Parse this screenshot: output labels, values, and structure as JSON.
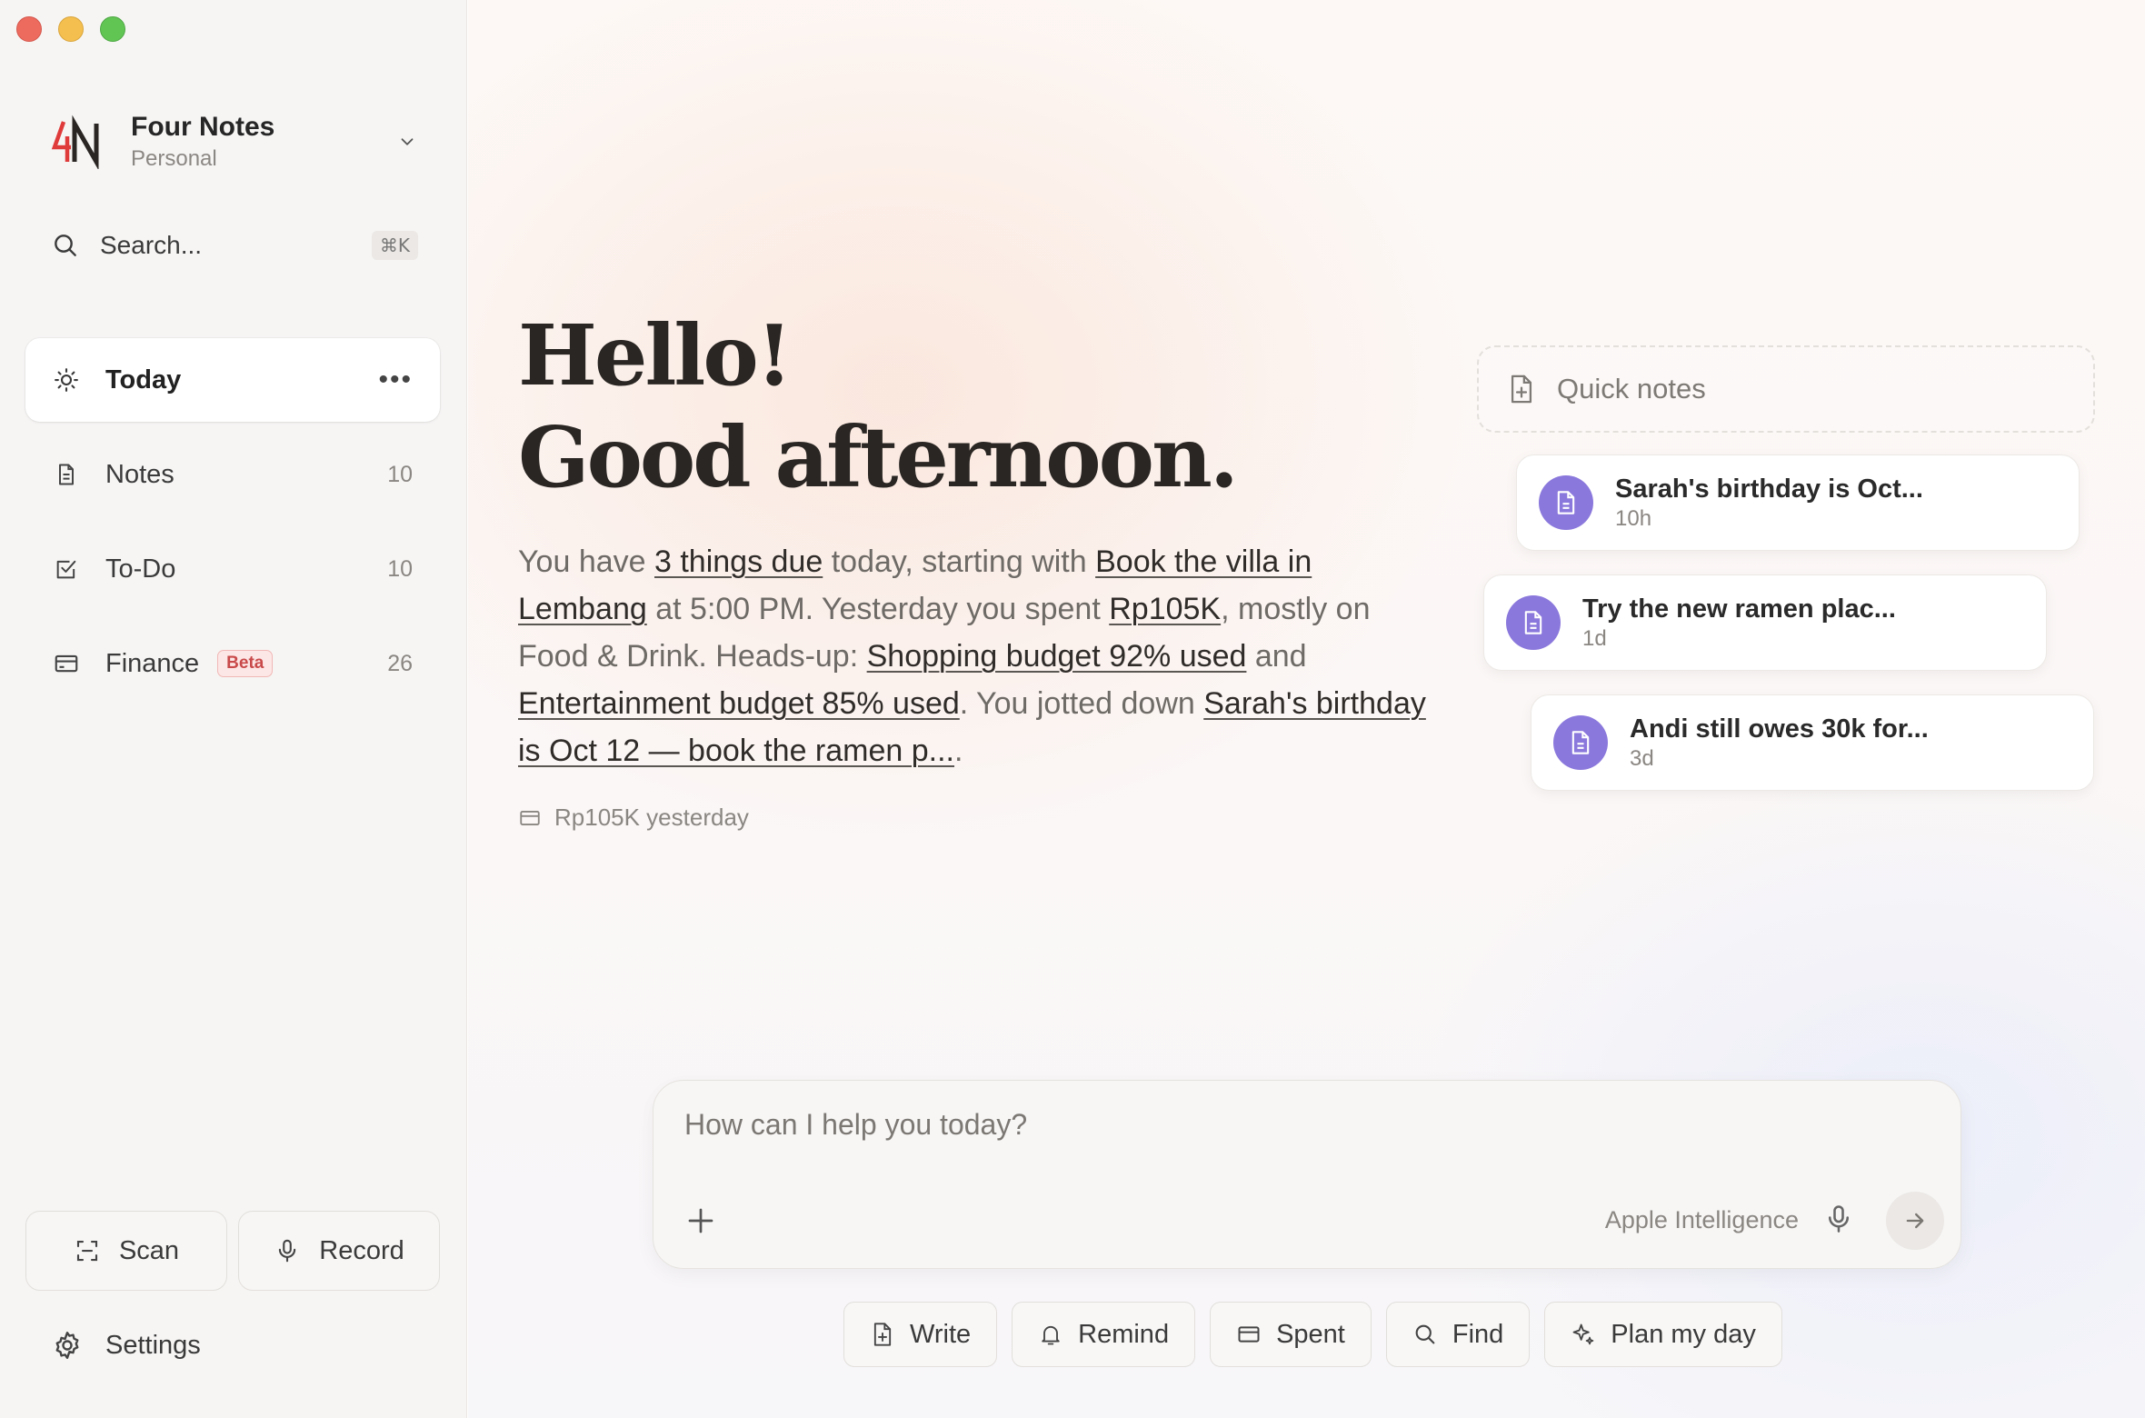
{
  "window": {
    "controls": [
      "close",
      "minimize",
      "zoom"
    ]
  },
  "workspace": {
    "name": "Four Notes",
    "subtitle": "Personal",
    "logo_text": "4N"
  },
  "search": {
    "placeholder": "Search...",
    "shortcut": "⌘K"
  },
  "nav": {
    "items": [
      {
        "label": "Today",
        "icon": "sun-icon",
        "active": true
      },
      {
        "label": "Notes",
        "icon": "document-icon",
        "count": "10"
      },
      {
        "label": "To-Do",
        "icon": "checkbox-icon",
        "count": "10"
      },
      {
        "label": "Finance",
        "icon": "card-icon",
        "badge": "Beta",
        "count": "26"
      }
    ]
  },
  "sidebar_actions": {
    "scan": "Scan",
    "record": "Record",
    "settings": "Settings"
  },
  "greeting": {
    "line1": "Hello!",
    "line2": "Good afternoon."
  },
  "summary": {
    "t1": "You have ",
    "l1": "3 things due",
    "t2": " today, starting with ",
    "l2": "Book the villa in Lembang",
    "t3": " at 5:00 PM. Yesterday you spent ",
    "l3": "Rp105K",
    "t4": ", mostly on Food & Drink. Heads-up: ",
    "l4": "Shopping budget 92% used",
    "t5": " and ",
    "l5": "Entertainment budget 85% used",
    "t6": ". You jotted down ",
    "l6": "Sarah's birthday is Oct 12 — book the ramen p...",
    "t7": "."
  },
  "meta": {
    "spent": "Rp105K yesterday"
  },
  "quick_notes": {
    "label": "Quick notes",
    "cards": [
      {
        "title": "Sarah's birthday is Oct...",
        "age": "10h"
      },
      {
        "title": "Try the new ramen plac...",
        "age": "1d"
      },
      {
        "title": "Andi still owes 30k for...",
        "age": "3d"
      }
    ]
  },
  "composer": {
    "placeholder": "How can I help you today?",
    "model": "Apple Intelligence"
  },
  "chips": [
    "Write",
    "Remind",
    "Spent",
    "Find",
    "Plan my day"
  ],
  "colors": {
    "accent": "#8b78dc",
    "badge": "#c94a4a",
    "logo_red": "#e03b3b"
  }
}
